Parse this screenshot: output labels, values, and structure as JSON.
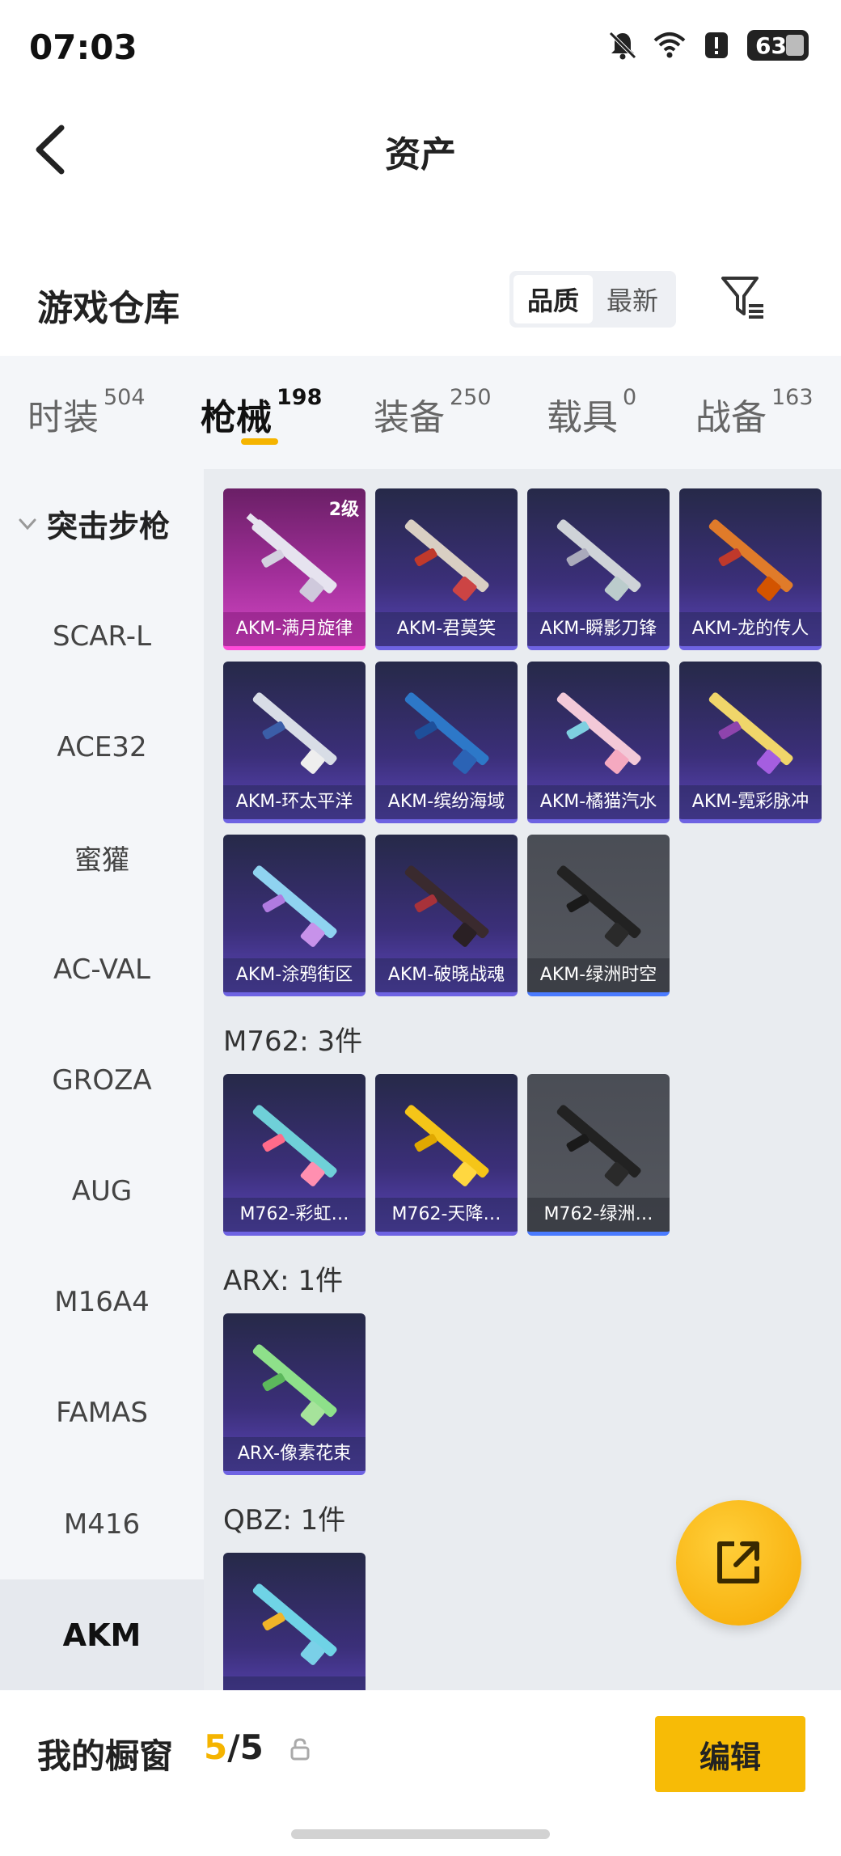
{
  "status_bar": {
    "time": "07:03",
    "battery": "63"
  },
  "header": {
    "title": "资产"
  },
  "warehouse": {
    "title": "游戏仓库",
    "sort_options": [
      "品质",
      "最新"
    ],
    "active_sort": "品质"
  },
  "tabs": [
    {
      "label": "时装",
      "count": "504"
    },
    {
      "label": "枪械",
      "count": "198"
    },
    {
      "label": "装备",
      "count": "250"
    },
    {
      "label": "载具",
      "count": "0"
    },
    {
      "label": "战备",
      "count": "163"
    }
  ],
  "active_tab": "枪械",
  "sidebar": {
    "group_label": "突击步枪",
    "items": [
      "SCAR-L",
      "ACE32",
      "蜜獾",
      "AC-VAL",
      "GROZA",
      "AUG",
      "M16A4",
      "FAMAS",
      "M416",
      "AKM"
    ],
    "active_item": "AKM"
  },
  "akm_items": [
    {
      "name": "AKM-满月旋律",
      "level": "2级",
      "tier": "pink"
    },
    {
      "name": "AKM-君莫笑",
      "tier": "purple"
    },
    {
      "name": "AKM-瞬影刀锋",
      "tier": "purple"
    },
    {
      "name": "AKM-龙的传人",
      "tier": "purple"
    },
    {
      "name": "AKM-环太平洋",
      "tier": "purple"
    },
    {
      "name": "AKM-缤纷海域",
      "tier": "purple"
    },
    {
      "name": "AKM-橘猫汽水",
      "tier": "purple"
    },
    {
      "name": "AKM-霓彩脉冲",
      "tier": "purple"
    },
    {
      "name": "AKM-涂鸦街区",
      "tier": "purple"
    },
    {
      "name": "AKM-破晓战魂",
      "tier": "purple"
    },
    {
      "name": "AKM-绿洲时空",
      "tier": "grey"
    }
  ],
  "groups": [
    {
      "title": "M762: 3件",
      "items": [
        {
          "name": "M762-彩虹…",
          "tier": "purple"
        },
        {
          "name": "M762-天降…",
          "tier": "purple"
        },
        {
          "name": "M762-绿洲…",
          "tier": "grey"
        }
      ]
    },
    {
      "title": "ARX: 1件",
      "items": [
        {
          "name": "ARX-像素花束",
          "tier": "purple"
        }
      ]
    },
    {
      "title": "QBZ: 1件",
      "items": [
        {
          "name": "",
          "tier": "purple"
        }
      ]
    }
  ],
  "showcase": {
    "label": "我的橱窗",
    "current": "5",
    "separator": "/",
    "max": "5",
    "edit_label": "编辑"
  },
  "colors": {
    "accent": "#f5b400",
    "rare_purple": "#5a45b8",
    "epic_pink": "#d347c4",
    "common_grey": "#55585f"
  },
  "icons": [
    "back-arrow-icon",
    "filter-icon",
    "chevron-down-icon",
    "share-icon",
    "lock-icon",
    "bell-off-icon",
    "wifi-icon",
    "alert-icon"
  ]
}
